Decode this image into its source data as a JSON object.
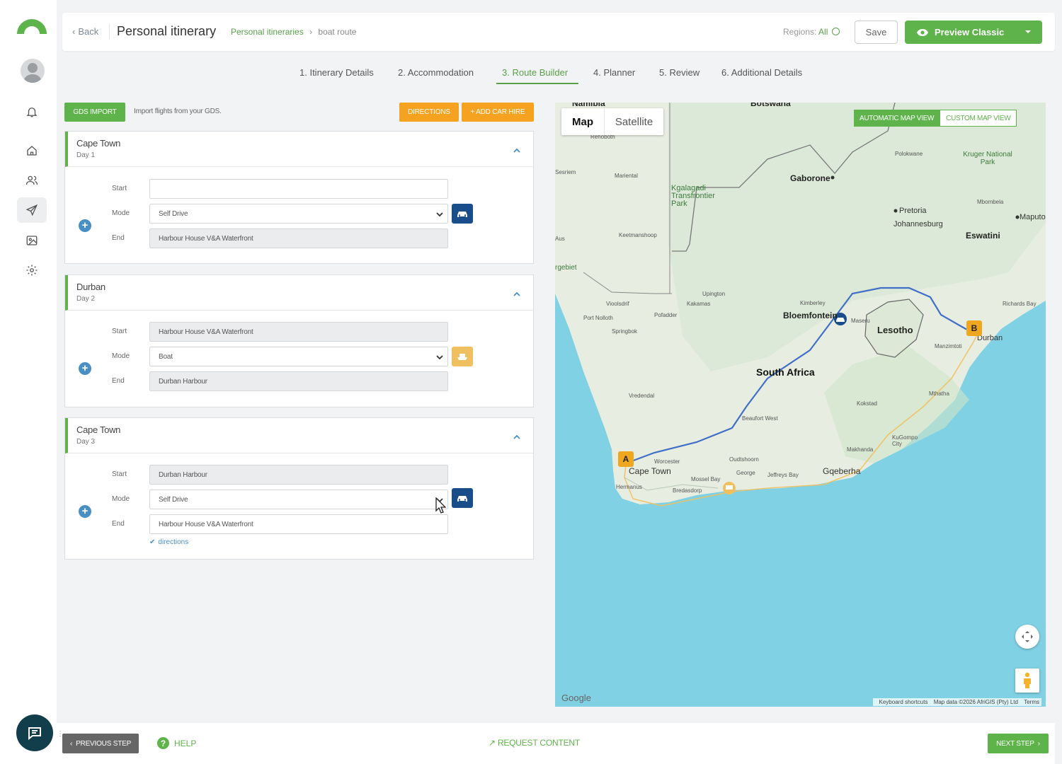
{
  "header": {
    "back_label": "Back",
    "title": "Personal itinerary",
    "breadcrumb_link": "Personal itineraries",
    "breadcrumb_sep": "›",
    "breadcrumb_current": "boat route",
    "regions_label": "Regions:",
    "regions_value": "All",
    "save_label": "Save",
    "preview_label": "Preview Classic"
  },
  "steps": [
    {
      "label": "1. Itinerary Details"
    },
    {
      "label": "2. Accommodation"
    },
    {
      "label": "3. Route Builder",
      "active": true
    },
    {
      "label": "4. Planner"
    },
    {
      "label": "5. Review"
    },
    {
      "label": "6. Additional Details"
    }
  ],
  "toolbar": {
    "gds_label": "GDS IMPORT",
    "gds_text": "Import flights from your GDS.",
    "directions_label": "DIRECTIONS",
    "car_hire_label": "+ ADD CAR HIRE"
  },
  "labels": {
    "start": "Start",
    "mode": "Mode",
    "end": "End"
  },
  "legs": [
    {
      "city": "Cape Town",
      "day": "Day 1",
      "start": "",
      "mode": "Self Drive",
      "end": "Harbour House V&A Waterfront",
      "mode_icon": "car-icon"
    },
    {
      "city": "Durban",
      "day": "Day 2",
      "start": "Harbour House V&A Waterfront",
      "mode": "Boat",
      "end": "Durban Harbour",
      "mode_icon": "boat-icon"
    },
    {
      "city": "Cape Town",
      "day": "Day 3",
      "start": "Durban Harbour",
      "mode": "Self Drive",
      "end": "Harbour House V&A Waterfront",
      "mode_icon": "car-icon",
      "directions": "directions"
    }
  ],
  "map": {
    "type_map": "Map",
    "type_satellite": "Satellite",
    "auto_view": "AUTOMATIC MAP VIEW",
    "custom_view": "CUSTOM MAP VIEW",
    "google": "Google",
    "footer_shortcuts": "Keyboard shortcuts",
    "footer_data": "Map data ©2026 AfriGIS (Pty) Ltd",
    "footer_terms": "Terms",
    "pin_a": "A",
    "pin_b": "B",
    "labels": {
      "namibia": "Namibia",
      "botswana": "Botswana",
      "gaborone": "Gaborone",
      "rehoboth": "Rehoboth",
      "mariental": "Mariental",
      "keetmanshoop": "Keetmanshoop",
      "kgalagadi": "Kgalagadi Transfrontier Park",
      "polokwane": "Polokwane",
      "kruger": "Kruger National Park",
      "pretoria": "Pretoria",
      "johannesburg": "Johannesburg",
      "mbombela": "Mbombela",
      "maputo": "Maputo",
      "eswatini": "Eswatini",
      "upington": "Upington",
      "kakamas": "Kakamas",
      "kimberley": "Kimberley",
      "bloemfontein": "Bloemfontein",
      "maseru": "Maseru",
      "lesotho": "Lesotho",
      "durban": "Durban",
      "richards_bay": "Richards Bay",
      "port_nolloth": "Port Nolloth",
      "springbok": "Springbok",
      "pofadder": "Pofadder",
      "vioolsdrif": "Vioolsdrif",
      "south_africa": "South Africa",
      "vredendal": "Vredendal",
      "beaufort_west": "Beaufort West",
      "worcester": "Worcester",
      "cape_town": "Cape Town",
      "hermanus": "Hermanus",
      "bredasdorp": "Bredasdorp",
      "mossel_bay": "Mossel Bay",
      "george": "George",
      "oudtshoorn": "Oudtshoorn",
      "jeffreys_bay": "Jeffreys Bay",
      "gqeberha": "Gqeberha",
      "makhanda": "Makhanda",
      "kugompo": "KuGompo City",
      "mthatha": "Mthatha",
      "kokstad": "Kokstad",
      "manzimtoti": "Manzimtoti",
      "sesriem": "Sesriem",
      "aus": "Aus",
      "ruger": "rgebiet"
    }
  },
  "footer": {
    "prev_label": "PREVIOUS STEP",
    "help_label": "HELP",
    "request_label": "REQUEST CONTENT",
    "next_label": "NEXT STEP"
  },
  "colors": {
    "brand_green": "#5eb44a",
    "accent_orange": "#f4a21f",
    "car_badge": "#1a4e8a",
    "boat_badge": "#f0c060",
    "ocean": "#7fd1e3",
    "route": "#3f6fc7"
  }
}
